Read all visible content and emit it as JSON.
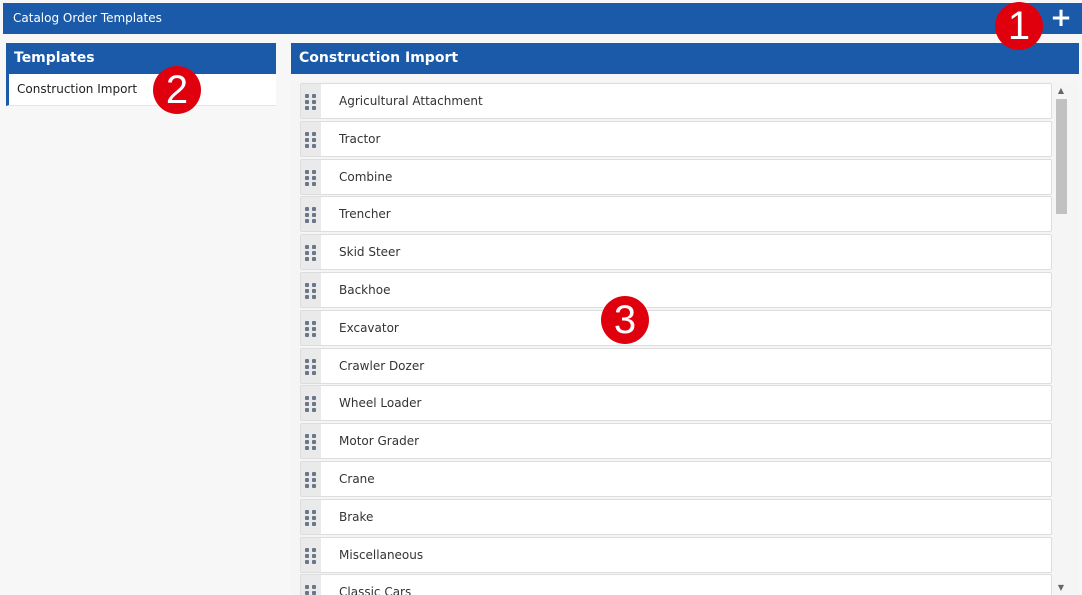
{
  "app": {
    "title": "Catalog Order Templates",
    "add_label": "+"
  },
  "templates_panel": {
    "heading": "Templates",
    "items": [
      "Construction Import"
    ]
  },
  "detail_panel": {
    "heading": "Construction Import"
  },
  "list": [
    "Agricultural Attachment",
    "Tractor",
    "Combine",
    "Trencher",
    "Skid Steer",
    "Backhoe",
    "Excavator",
    "Crawler Dozer",
    "Wheel Loader",
    "Motor Grader",
    "Crane",
    "Brake",
    "Miscellaneous",
    "Classic Cars"
  ],
  "scrollbar": {
    "up": "▲",
    "down": "▼"
  },
  "callouts": [
    "1",
    "2",
    "3"
  ],
  "colors": {
    "header": "#1a5aa8",
    "callout": "#e0000d"
  }
}
